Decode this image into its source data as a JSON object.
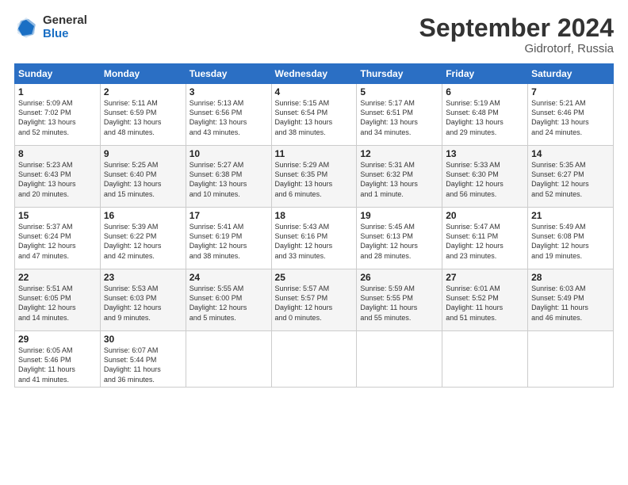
{
  "logo": {
    "general": "General",
    "blue": "Blue"
  },
  "header": {
    "title": "September 2024",
    "subtitle": "Gidrotorf, Russia"
  },
  "weekdays": [
    "Sunday",
    "Monday",
    "Tuesday",
    "Wednesday",
    "Thursday",
    "Friday",
    "Saturday"
  ],
  "weeks": [
    [
      {
        "day": "1",
        "info": "Sunrise: 5:09 AM\nSunset: 7:02 PM\nDaylight: 13 hours\nand 52 minutes."
      },
      {
        "day": "2",
        "info": "Sunrise: 5:11 AM\nSunset: 6:59 PM\nDaylight: 13 hours\nand 48 minutes."
      },
      {
        "day": "3",
        "info": "Sunrise: 5:13 AM\nSunset: 6:56 PM\nDaylight: 13 hours\nand 43 minutes."
      },
      {
        "day": "4",
        "info": "Sunrise: 5:15 AM\nSunset: 6:54 PM\nDaylight: 13 hours\nand 38 minutes."
      },
      {
        "day": "5",
        "info": "Sunrise: 5:17 AM\nSunset: 6:51 PM\nDaylight: 13 hours\nand 34 minutes."
      },
      {
        "day": "6",
        "info": "Sunrise: 5:19 AM\nSunset: 6:48 PM\nDaylight: 13 hours\nand 29 minutes."
      },
      {
        "day": "7",
        "info": "Sunrise: 5:21 AM\nSunset: 6:46 PM\nDaylight: 13 hours\nand 24 minutes."
      }
    ],
    [
      {
        "day": "8",
        "info": "Sunrise: 5:23 AM\nSunset: 6:43 PM\nDaylight: 13 hours\nand 20 minutes."
      },
      {
        "day": "9",
        "info": "Sunrise: 5:25 AM\nSunset: 6:40 PM\nDaylight: 13 hours\nand 15 minutes."
      },
      {
        "day": "10",
        "info": "Sunrise: 5:27 AM\nSunset: 6:38 PM\nDaylight: 13 hours\nand 10 minutes."
      },
      {
        "day": "11",
        "info": "Sunrise: 5:29 AM\nSunset: 6:35 PM\nDaylight: 13 hours\nand 6 minutes."
      },
      {
        "day": "12",
        "info": "Sunrise: 5:31 AM\nSunset: 6:32 PM\nDaylight: 13 hours\nand 1 minute."
      },
      {
        "day": "13",
        "info": "Sunrise: 5:33 AM\nSunset: 6:30 PM\nDaylight: 12 hours\nand 56 minutes."
      },
      {
        "day": "14",
        "info": "Sunrise: 5:35 AM\nSunset: 6:27 PM\nDaylight: 12 hours\nand 52 minutes."
      }
    ],
    [
      {
        "day": "15",
        "info": "Sunrise: 5:37 AM\nSunset: 6:24 PM\nDaylight: 12 hours\nand 47 minutes."
      },
      {
        "day": "16",
        "info": "Sunrise: 5:39 AM\nSunset: 6:22 PM\nDaylight: 12 hours\nand 42 minutes."
      },
      {
        "day": "17",
        "info": "Sunrise: 5:41 AM\nSunset: 6:19 PM\nDaylight: 12 hours\nand 38 minutes."
      },
      {
        "day": "18",
        "info": "Sunrise: 5:43 AM\nSunset: 6:16 PM\nDaylight: 12 hours\nand 33 minutes."
      },
      {
        "day": "19",
        "info": "Sunrise: 5:45 AM\nSunset: 6:13 PM\nDaylight: 12 hours\nand 28 minutes."
      },
      {
        "day": "20",
        "info": "Sunrise: 5:47 AM\nSunset: 6:11 PM\nDaylight: 12 hours\nand 23 minutes."
      },
      {
        "day": "21",
        "info": "Sunrise: 5:49 AM\nSunset: 6:08 PM\nDaylight: 12 hours\nand 19 minutes."
      }
    ],
    [
      {
        "day": "22",
        "info": "Sunrise: 5:51 AM\nSunset: 6:05 PM\nDaylight: 12 hours\nand 14 minutes."
      },
      {
        "day": "23",
        "info": "Sunrise: 5:53 AM\nSunset: 6:03 PM\nDaylight: 12 hours\nand 9 minutes."
      },
      {
        "day": "24",
        "info": "Sunrise: 5:55 AM\nSunset: 6:00 PM\nDaylight: 12 hours\nand 5 minutes."
      },
      {
        "day": "25",
        "info": "Sunrise: 5:57 AM\nSunset: 5:57 PM\nDaylight: 12 hours\nand 0 minutes."
      },
      {
        "day": "26",
        "info": "Sunrise: 5:59 AM\nSunset: 5:55 PM\nDaylight: 11 hours\nand 55 minutes."
      },
      {
        "day": "27",
        "info": "Sunrise: 6:01 AM\nSunset: 5:52 PM\nDaylight: 11 hours\nand 51 minutes."
      },
      {
        "day": "28",
        "info": "Sunrise: 6:03 AM\nSunset: 5:49 PM\nDaylight: 11 hours\nand 46 minutes."
      }
    ],
    [
      {
        "day": "29",
        "info": "Sunrise: 6:05 AM\nSunset: 5:46 PM\nDaylight: 11 hours\nand 41 minutes."
      },
      {
        "day": "30",
        "info": "Sunrise: 6:07 AM\nSunset: 5:44 PM\nDaylight: 11 hours\nand 36 minutes."
      },
      null,
      null,
      null,
      null,
      null
    ]
  ]
}
